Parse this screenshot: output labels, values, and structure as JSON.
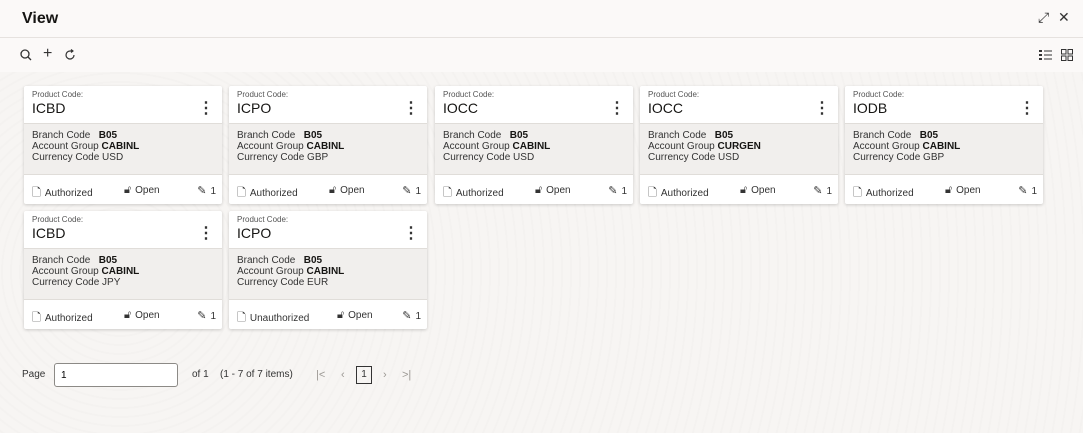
{
  "window": {
    "title": "View",
    "resize_icon": "expand-icon",
    "close_icon": "close-icon"
  },
  "toolbar": {
    "search_icon": "search-icon",
    "add_icon": "add-icon",
    "refresh_icon": "refresh-icon",
    "list_view_icon": "list-view-icon",
    "grid_view_icon": "grid-view-icon"
  },
  "labels": {
    "product_code": "Product Code:",
    "branch_code": "Branch Code",
    "account_group": "Account Group",
    "currency_code": "Currency Code"
  },
  "cards": [
    {
      "product_code": "ICBD",
      "branch": "B05",
      "account_group": "CABINL",
      "currency": "USD",
      "status": "Authorized",
      "lock": "Open",
      "version": "1"
    },
    {
      "product_code": "ICPO",
      "branch": "B05",
      "account_group": "CABINL",
      "currency": "GBP",
      "status": "Authorized",
      "lock": "Open",
      "version": "1"
    },
    {
      "product_code": "IOCC",
      "branch": "B05",
      "account_group": "CABINL",
      "currency": "USD",
      "status": "Authorized",
      "lock": "Open",
      "version": "1"
    },
    {
      "product_code": "IOCC",
      "branch": "B05",
      "account_group": "CURGEN",
      "currency": "USD",
      "status": "Authorized",
      "lock": "Open",
      "version": "1"
    },
    {
      "product_code": "IODB",
      "branch": "B05",
      "account_group": "CABINL",
      "currency": "GBP",
      "status": "Authorized",
      "lock": "Open",
      "version": "1"
    },
    {
      "product_code": "ICBD",
      "branch": "B05",
      "account_group": "CABINL",
      "currency": "JPY",
      "status": "Authorized",
      "lock": "Open",
      "version": "1"
    },
    {
      "product_code": "ICPO",
      "branch": "B05",
      "account_group": "CABINL",
      "currency": "EUR",
      "status": "Unauthorized",
      "lock": "Open",
      "version": "1"
    }
  ],
  "pager": {
    "page_label": "Page",
    "page_value": "1",
    "of_label": "of 1",
    "items_label": "(1 - 7 of 7 items)",
    "current_page": "1"
  }
}
